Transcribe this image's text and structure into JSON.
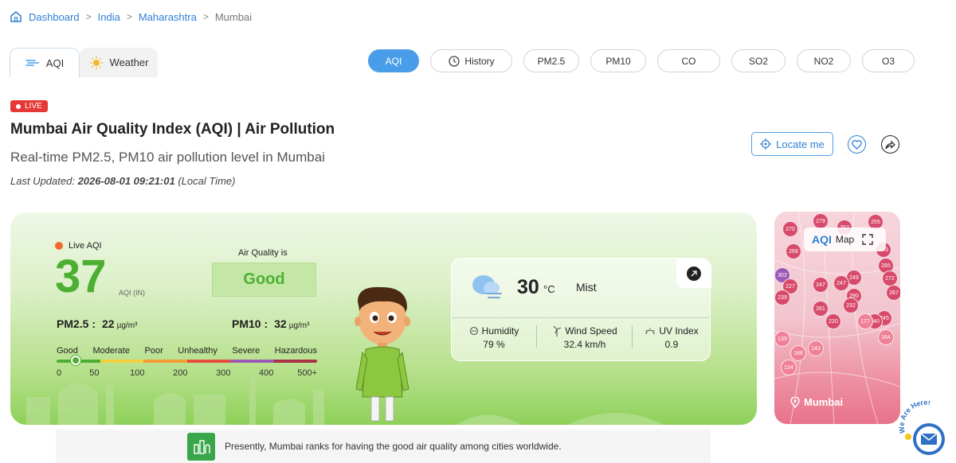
{
  "breadcrumb": {
    "items": [
      "Dashboard",
      "India",
      "Maharashtra",
      "Mumbai"
    ],
    "separator": ">"
  },
  "tabs": [
    {
      "label": "AQI"
    },
    {
      "label": "Weather"
    }
  ],
  "pills": [
    "AQI",
    "History",
    "PM2.5",
    "PM10",
    "CO",
    "SO2",
    "NO2",
    "O3"
  ],
  "header": {
    "live_badge": "LIVE",
    "title": "Mumbai Air Quality Index (AQI) | Air Pollution",
    "subtitle": "Real-time PM2.5, PM10 air pollution level in Mumbai",
    "updated_prefix": "Last Updated: ",
    "updated_value": "2026-08-01 09:21:01",
    "updated_suffix": " (Local Time)",
    "locate_label": "Locate me"
  },
  "aqi": {
    "live_label": "Live AQI",
    "value": "37",
    "unit": "AQI (IN)",
    "quality_label": "Air Quality is",
    "quality_status": "Good",
    "pm25_label": "PM2.5 :",
    "pm25_value": "22",
    "pm25_unit": "µg/m³",
    "pm10_label": "PM10 :",
    "pm10_value": "32",
    "pm10_unit": "µg/m³",
    "scale_fraction": 0.074,
    "scale_labels": [
      "Good",
      "Moderate",
      "Poor",
      "Unhealthy",
      "Severe",
      "Hazardous"
    ],
    "scale_nums": [
      "0",
      "50",
      "100",
      "200",
      "300",
      "400",
      "500+"
    ],
    "scale_colors": [
      "#4caf32",
      "#f4d03f",
      "#f39c33",
      "#e74c3c",
      "#9b59b6",
      "#a93246"
    ]
  },
  "weather": {
    "temp": "30",
    "temp_unit": "°C",
    "condition": "Mist",
    "humidity_label": "Humidity",
    "humidity_value": "79 %",
    "wind_label": "Wind Speed",
    "wind_value": "32.4 km/h",
    "uv_label": "UV Index",
    "uv_value": "0.9"
  },
  "map": {
    "logo": "AQI",
    "label": "Map",
    "city": "Mumbai",
    "markers": [
      "279",
      "255",
      "270",
      "257",
      "268",
      "243",
      "285",
      "302",
      "227",
      "272",
      "249",
      "247",
      "247",
      "290",
      "239",
      "267",
      "261",
      "232",
      "245",
      "240",
      "220",
      "177",
      "164",
      "139",
      "143",
      "188",
      "134"
    ]
  },
  "rank": {
    "text": "Presently, Mumbai ranks for having the good air quality among cities worldwide."
  },
  "contact": {
    "text": "We Are Here!"
  }
}
